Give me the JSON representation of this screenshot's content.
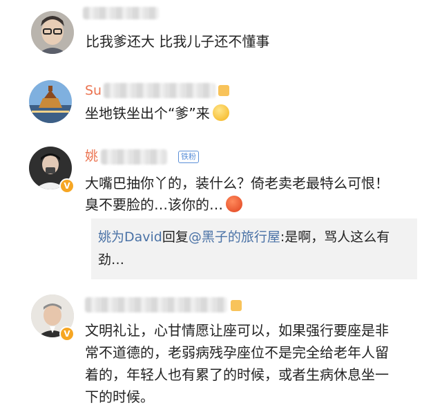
{
  "comments": [
    {
      "name": "",
      "lines": [
        "比我爹还大 比我儿子还不懂事"
      ]
    },
    {
      "name": "Su",
      "lines": [
        "坐地铁坐出个“爹”来"
      ],
      "emoji": "thinking-face"
    },
    {
      "name": "姚",
      "fan_tag": "铁粉",
      "verified": "V",
      "lines": [
        "大嘴巴抽你丫的，装什么？倚老卖老最特么可恨！",
        "臭不要脸的…该你的…"
      ],
      "emoji": "angry-face",
      "reply": {
        "author": "姚为David",
        "verb": "回复",
        "target": "@黑子的旅行屋",
        "line1_tail": ":是啊，骂人这么有",
        "line2": "劲…"
      }
    },
    {
      "name": "",
      "verified": "V",
      "lines": [
        "文明礼让，心甘情愿让座可以，如果强行要座是非",
        "常不道德的，老弱病残孕座位不是完全给老年人留",
        "着的，年轻人也有累了的时候，或者生病休息坐一",
        "下的时候。"
      ]
    }
  ],
  "colors": {
    "name_orange": "#eb7350",
    "link_blue": "#4a72a6",
    "reply_bg": "#f2f2f2",
    "verified_badge": "#f6a623"
  }
}
